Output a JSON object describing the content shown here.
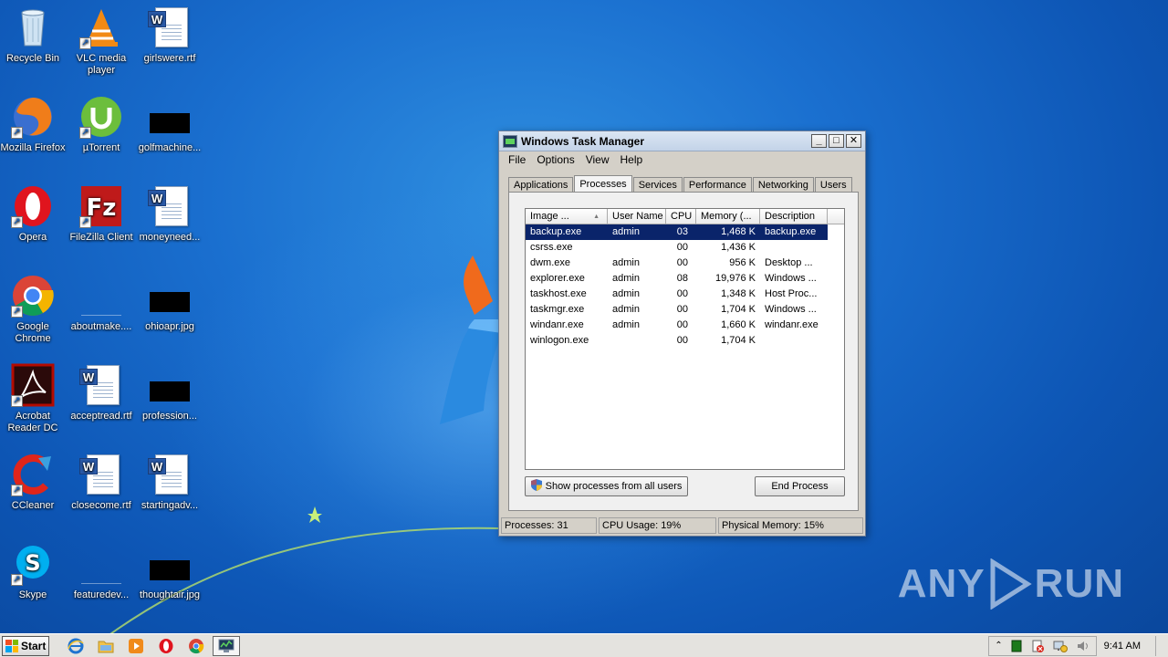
{
  "desktop": {
    "icons": [
      {
        "label": "Recycle Bin",
        "icon": "recycle-bin-icon"
      },
      {
        "label": "VLC media player",
        "icon": "vlc-icon"
      },
      {
        "label": "girlswere.rtf",
        "icon": "word-document-icon"
      },
      {
        "label": "Mozilla Firefox",
        "icon": "firefox-icon"
      },
      {
        "label": "µTorrent",
        "icon": "utorrent-icon"
      },
      {
        "label": "golfmachine...",
        "icon": "image-thumbnail-icon"
      },
      {
        "label": "Opera",
        "icon": "opera-icon"
      },
      {
        "label": "FileZilla Client",
        "icon": "filezilla-icon"
      },
      {
        "label": "moneyneed...",
        "icon": "word-document-icon"
      },
      {
        "label": "Google Chrome",
        "icon": "chrome-icon"
      },
      {
        "label": "aboutmake....",
        "icon": "blank-file-icon"
      },
      {
        "label": "ohioapr.jpg",
        "icon": "image-thumbnail-icon"
      },
      {
        "label": "Acrobat Reader DC",
        "icon": "acrobat-icon"
      },
      {
        "label": "acceptread.rtf",
        "icon": "word-document-icon"
      },
      {
        "label": "profession...",
        "icon": "image-thumbnail-icon"
      },
      {
        "label": "CCleaner",
        "icon": "ccleaner-icon"
      },
      {
        "label": "closecome.rtf",
        "icon": "word-document-icon"
      },
      {
        "label": "startingadv...",
        "icon": "word-document-icon"
      },
      {
        "label": "Skype",
        "icon": "skype-icon"
      },
      {
        "label": "featuredev...",
        "icon": "blank-file-icon"
      },
      {
        "label": "thoughtair.jpg",
        "icon": "image-thumbnail-icon"
      }
    ]
  },
  "task_manager": {
    "title": "Windows Task Manager",
    "controls": {
      "minimize": "_",
      "maximize": "□",
      "close": "✕"
    },
    "menu": [
      "File",
      "Options",
      "View",
      "Help"
    ],
    "tabs": [
      "Applications",
      "Processes",
      "Services",
      "Performance",
      "Networking",
      "Users"
    ],
    "active_tab": "Processes",
    "columns": [
      "Image ...",
      "User Name",
      "CPU",
      "Memory (...",
      "Description"
    ],
    "sort_indicator": "▲",
    "processes": [
      {
        "name": "backup.exe",
        "user": "admin",
        "cpu": "03",
        "memory": "1,468 K",
        "description": "backup.exe",
        "selected": true
      },
      {
        "name": "csrss.exe",
        "user": "",
        "cpu": "00",
        "memory": "1,436 K",
        "description": ""
      },
      {
        "name": "dwm.exe",
        "user": "admin",
        "cpu": "00",
        "memory": "956 K",
        "description": "Desktop ..."
      },
      {
        "name": "explorer.exe",
        "user": "admin",
        "cpu": "08",
        "memory": "19,976 K",
        "description": "Windows ..."
      },
      {
        "name": "taskhost.exe",
        "user": "admin",
        "cpu": "00",
        "memory": "1,348 K",
        "description": "Host Proc..."
      },
      {
        "name": "taskmgr.exe",
        "user": "admin",
        "cpu": "00",
        "memory": "1,704 K",
        "description": "Windows ..."
      },
      {
        "name": "windanr.exe",
        "user": "admin",
        "cpu": "00",
        "memory": "1,660 K",
        "description": "windanr.exe"
      },
      {
        "name": "winlogon.exe",
        "user": "",
        "cpu": "00",
        "memory": "1,704 K",
        "description": ""
      }
    ],
    "show_all_button": "Show processes from all users",
    "end_process_button": "End Process",
    "status": {
      "processes": "Processes: 31",
      "cpu": "CPU Usage: 19%",
      "memory": "Physical Memory: 15%"
    }
  },
  "watermark": {
    "left": "ANY",
    "right": "RUN"
  },
  "taskbar": {
    "start_label": "Start",
    "pinned": [
      "internet-explorer-icon",
      "explorer-folder-icon",
      "media-player-icon",
      "opera-icon",
      "chrome-icon",
      "task-manager-icon"
    ],
    "tray_icons": [
      "show-hidden-icons-icon",
      "network-monitor-icon",
      "action-center-icon",
      "network-icon",
      "volume-icon"
    ],
    "clock": "9:41 AM"
  }
}
